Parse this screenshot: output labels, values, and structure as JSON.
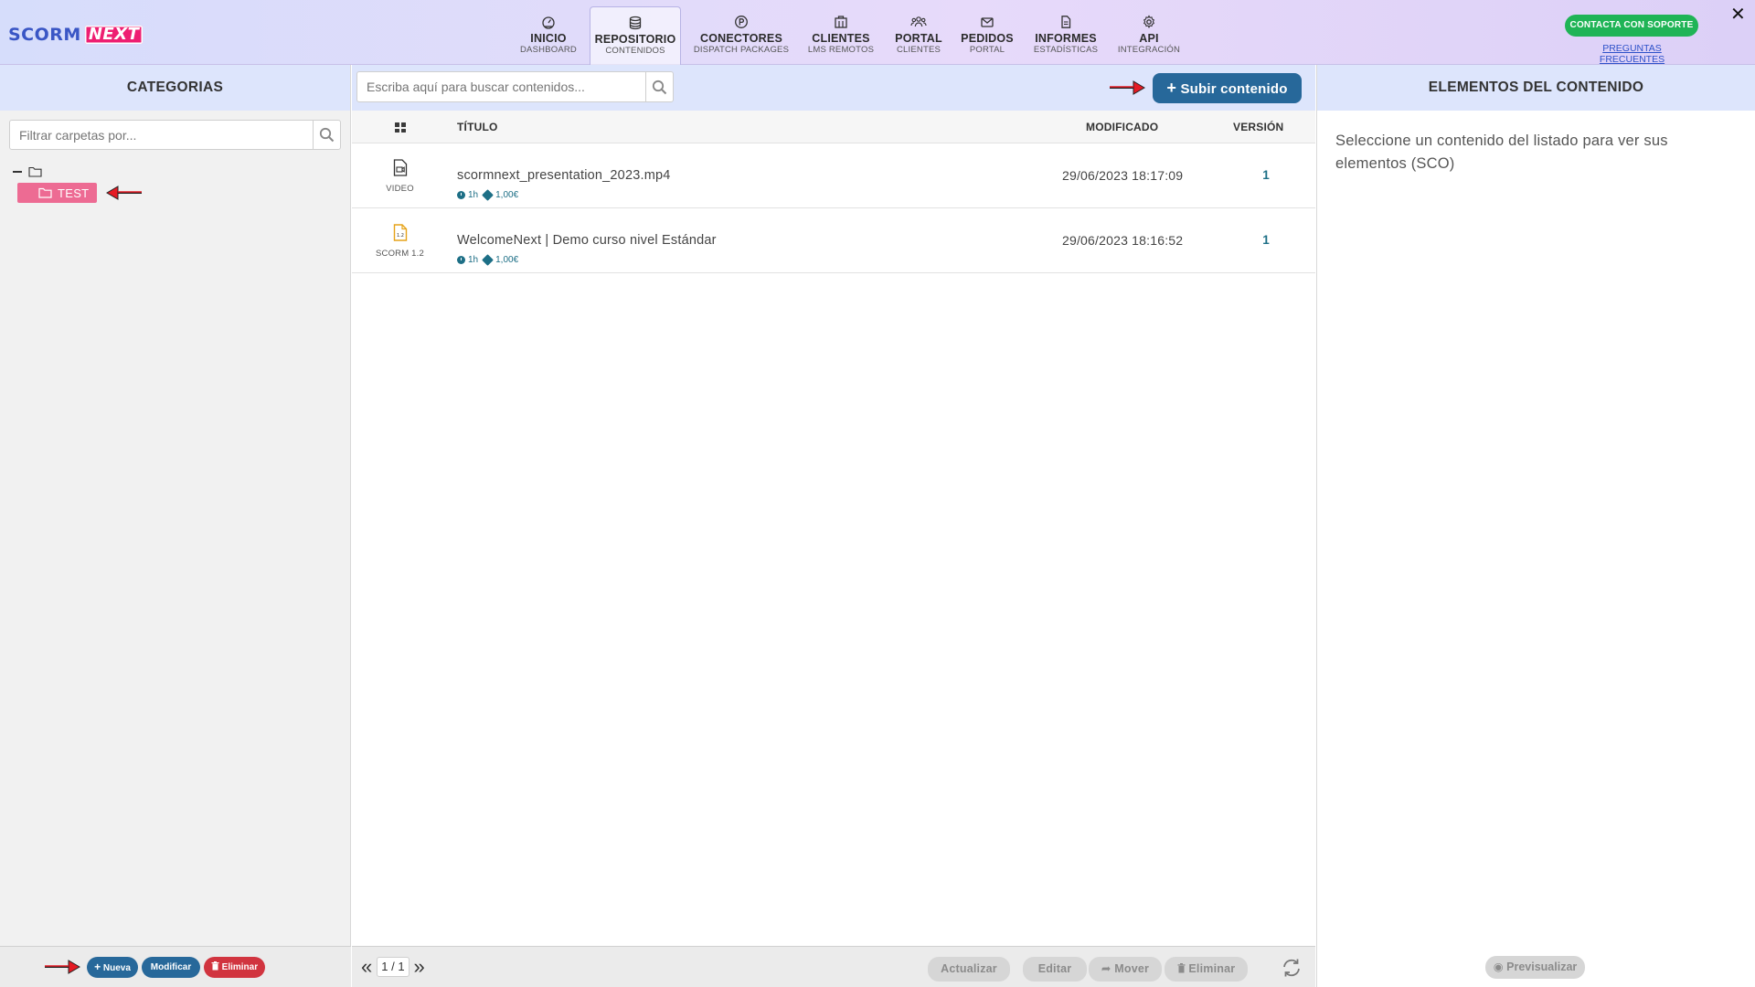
{
  "app": {
    "logo_left": "SCORM",
    "logo_right": "NEXT",
    "brand_colors": {
      "primary_blue": "#3a56c5",
      "accent_pink": "#ee1f72",
      "teal": "#1d6f86",
      "upload_btn": "#27689a",
      "support_green": "#1fb456"
    }
  },
  "nav": {
    "items": [
      {
        "label": "INICIO",
        "sub": "DASHBOARD",
        "icon": "gauge-icon"
      },
      {
        "label": "REPOSITORIO",
        "sub": "CONTENIDOS",
        "icon": "database-icon",
        "active": true
      },
      {
        "label": "CONECTORES",
        "sub": "DISPATCH PACKAGES",
        "icon": "circle-p-icon"
      },
      {
        "label": "CLIENTES",
        "sub": "LMS REMOTOS",
        "icon": "building-icon"
      },
      {
        "label": "PORTAL",
        "sub": "CLIENTES",
        "icon": "users-icon"
      },
      {
        "label": "PEDIDOS",
        "sub": "PORTAL",
        "icon": "envelope-icon"
      },
      {
        "label": "INFORMES",
        "sub": "ESTADÍSTICAS",
        "icon": "document-icon"
      },
      {
        "label": "API",
        "sub": "INTEGRACIÓN",
        "icon": "gear-icon"
      }
    ],
    "support_button": "CONTACTA CON SOPORTE",
    "faq_link": "PREGUNTAS FRECUENTES",
    "close": "✕"
  },
  "categories": {
    "title": "CATEGORIAS",
    "filter_placeholder": "Filtrar carpetas por...",
    "folders": [
      {
        "label": "TEST",
        "selected": true
      }
    ],
    "buttons": {
      "new": "Nueva",
      "modify": "Modificar",
      "delete": "Eliminar"
    }
  },
  "contents": {
    "search_placeholder": "Escriba aquí para buscar contenidos...",
    "upload_button": "Subir contenido",
    "columns": {
      "title": "TÍTULO",
      "modified": "MODIFICADO",
      "version": "VERSIÓN"
    },
    "rows": [
      {
        "type": "VIDEO",
        "icon": "video-file-icon",
        "title": "scormnext_presentation_2023.mp4",
        "duration": "1h",
        "price": "1,00€",
        "modified": "29/06/2023 18:17:09",
        "version": "1"
      },
      {
        "type": "SCORM 1.2",
        "icon": "scorm-file-icon",
        "title": "WelcomeNext | Demo curso nivel Estándar",
        "duration": "1h",
        "price": "1,00€",
        "modified": "29/06/2023 18:16:52",
        "version": "1"
      }
    ],
    "pager": {
      "prev": "«",
      "page": "1 / 1",
      "next": "»"
    },
    "footer_buttons": {
      "refresh": "Actualizar",
      "edit": "Editar",
      "move": "Mover",
      "delete": "Eliminar"
    }
  },
  "elements": {
    "title": "ELEMENTOS DEL CONTENIDO",
    "empty_text": "Seleccione un contenido del listado para ver sus elementos (SCO)",
    "preview_button": "Previsualizar"
  }
}
